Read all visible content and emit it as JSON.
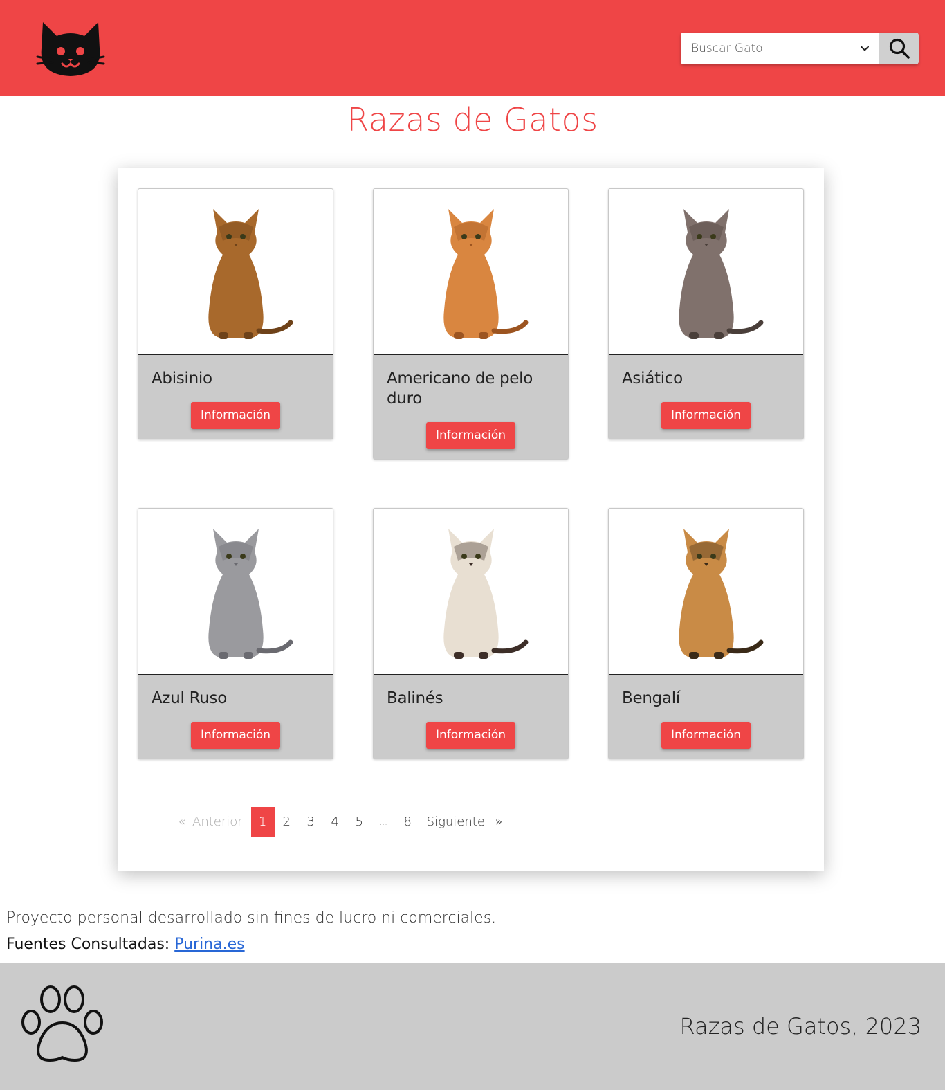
{
  "header": {
    "logo_icon": "cat-face-icon",
    "search": {
      "placeholder": "Buscar Gato",
      "dropdown_icon": "chevron-down-icon",
      "button_icon": "search-icon"
    }
  },
  "page": {
    "title": "Razas de Gatos"
  },
  "cards": [
    {
      "name": "Abisinio",
      "button": "Información",
      "fur": "#a8692c",
      "accent": "#6e4219"
    },
    {
      "name": "Americano de pelo duro",
      "button": "Información",
      "fur": "#d98640",
      "accent": "#9c5420"
    },
    {
      "name": "Asiático",
      "button": "Información",
      "fur": "#80716c",
      "accent": "#4a3f3a"
    },
    {
      "name": "Azul Ruso",
      "button": "Información",
      "fur": "#9a9a9e",
      "accent": "#6a6a70"
    },
    {
      "name": "Balinés",
      "button": "Información",
      "fur": "#e8dfd2",
      "accent": "#3d2e28"
    },
    {
      "name": "Bengalí",
      "button": "Información",
      "fur": "#c98b46",
      "accent": "#3a2a18"
    }
  ],
  "pagination": {
    "prev_arrow": "«",
    "prev_label": "Anterior",
    "pages": [
      "1",
      "2",
      "3",
      "4",
      "5",
      "...",
      "8"
    ],
    "active": "1",
    "next_label": "Siguiente",
    "next_arrow": "»"
  },
  "footer_note": {
    "text": "Proyecto personal desarrollado sin fines de lucro ni comerciales.",
    "sources_label": "Fuentes Consultadas:",
    "sources_link": "Purina.es"
  },
  "footer": {
    "paw_icon": "paw-icon",
    "title": "Razas de Gatos, 2023"
  },
  "colors": {
    "accent": "#ef4546",
    "footer_bg": "#cbcbcb",
    "card_bg": "#cbcbcb",
    "link": "#2867d6"
  }
}
